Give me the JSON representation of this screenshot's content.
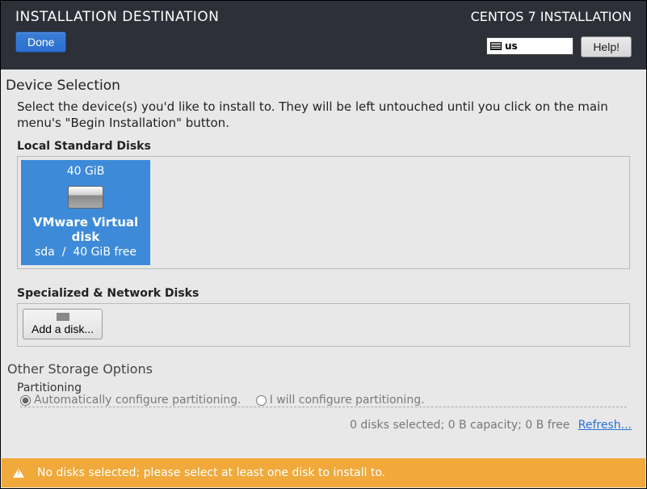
{
  "header": {
    "title": "INSTALLATION DESTINATION",
    "installer": "CENTOS 7 INSTALLATION",
    "done_label": "Done",
    "help_label": "Help!",
    "keyboard_layout": "us"
  },
  "device_selection": {
    "title": "Device Selection",
    "description": "Select the device(s) you'd like to install to.  They will be left untouched until you click on the main menu's \"Begin Installation\" button.",
    "local_label": "Local Standard Disks",
    "disks": [
      {
        "size": "40 GiB",
        "name": "VMware Virtual disk",
        "dev": "sda",
        "sep": "/",
        "free": "40 GiB free"
      }
    ],
    "network_label": "Specialized & Network Disks",
    "add_disk_label": "Add a disk..."
  },
  "other_storage": {
    "title": "Other Storage Options",
    "partitioning_label": "Partitioning",
    "auto_label": "Automatically configure partitioning.",
    "manual_label": "I will configure partitioning."
  },
  "status": {
    "text": "0 disks selected; 0 B capacity; 0 B free",
    "refresh_label": "Refresh..."
  },
  "warning": {
    "text": "No disks selected; please select at least one disk to install to."
  }
}
